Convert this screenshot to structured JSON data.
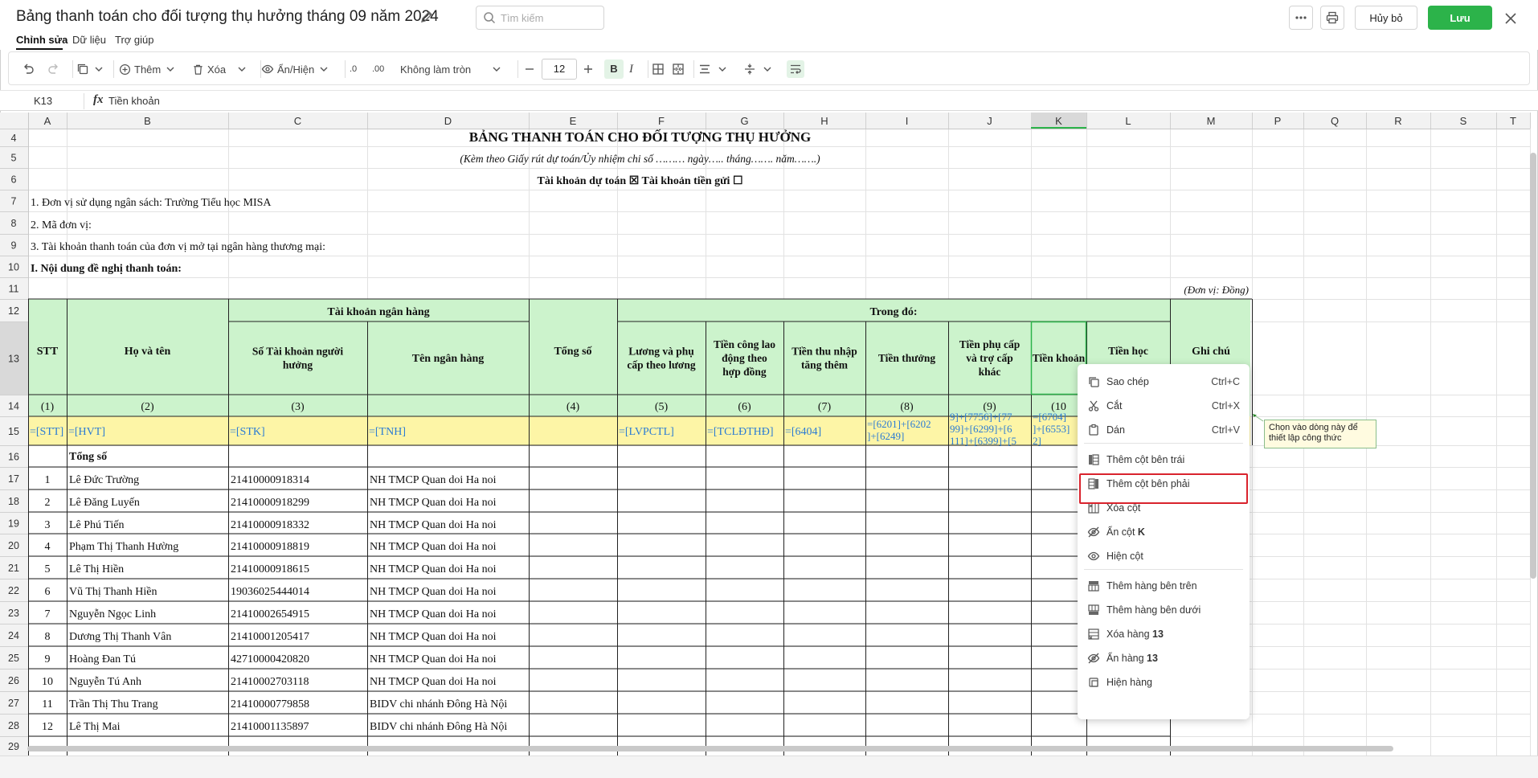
{
  "header": {
    "title": "Bảng thanh toán cho đối tượng thụ hưởng tháng 09 năm 2024",
    "search_placeholder": "Tìm kiếm",
    "tabs": [
      "Chỉnh sửa",
      "Dữ liệu",
      "Trợ giúp"
    ],
    "cancel_label": "Hủy bỏ",
    "save_label": "Lưu"
  },
  "toolbar": {
    "add_label": "Thêm",
    "delete_label": "Xóa",
    "show_hide_label": "Ẩn/Hiện",
    "decimal_down": ".0",
    "decimal_up": ".00",
    "rounding_value": "Không làm tròn",
    "font_size": "12",
    "bold_label": "B",
    "italic_label": "I"
  },
  "formula_bar": {
    "cell_ref": "K13",
    "fx": "fx",
    "value": "Tiền khoản"
  },
  "grid": {
    "columns": [
      "A",
      "B",
      "C",
      "D",
      "E",
      "F",
      "G",
      "H",
      "I",
      "J",
      "K",
      "L",
      "M",
      "P",
      "Q",
      "R",
      "S",
      "T"
    ],
    "selected_col": "K",
    "row_numbers": [
      "4",
      "5",
      "6",
      "7",
      "8",
      "9",
      "10",
      "11",
      "12",
      "13",
      "14",
      "15",
      "16",
      "17",
      "18",
      "19",
      "20",
      "21",
      "22",
      "23",
      "24",
      "25",
      "26",
      "27",
      "28",
      "29"
    ],
    "selected_row": "13",
    "title": "BẢNG THANH TOÁN CHO ĐỐI TƯỢNG THỤ HƯỞNG",
    "subtitle": "(Kèm theo Giấy rút dự toán/Ủy nhiệm chi số ……… ngày….. tháng……. năm…….)",
    "accounts": "Tài khoản dự toán ☒    Tài khoản tiền gửi ☐",
    "line7": "1. Đơn vị sử dụng ngân sách: Trường Tiểu học MISA",
    "line8": "2. Mã đơn vị:",
    "line9": "3. Tài khoản thanh toán của đơn vị mở tại ngân hàng thương mại:",
    "line10": "I. Nội dung đề nghị thanh toán:",
    "unit_note": "(Đơn vị: Đồng)",
    "hdr_stt": "STT",
    "hdr_name": "Họ và tên",
    "hdr_bank": "Tài khoản ngân hàng",
    "hdr_account": "Số Tài khoản người hưởng",
    "hdr_bankname": "Tên ngân hàng",
    "hdr_total": "Tổng số",
    "hdr_of_which": "Trong đó:",
    "hdr_note": "Ghi chú",
    "hdr_f": "Lương và phụ cấp theo lương",
    "hdr_g": "Tiền công lao động theo hợp đồng",
    "hdr_h": "Tiền thu nhập tăng thêm",
    "hdr_i": "Tiền thưởng",
    "hdr_j": "Tiền phụ cấp và trợ cấp khác",
    "hdr_k": "Tiền khoản",
    "hdr_l": "Tiền học",
    "row14": [
      "(1)",
      "(2)",
      "(3)",
      "",
      "(4)",
      "(5)",
      "(6)",
      "(7)",
      "(8)",
      "(9)",
      "(10"
    ],
    "row15": [
      "=[STT]",
      "=[HVT]",
      "=[STK]",
      "=[TNH]",
      "",
      "=[LVPCTL]",
      "=[TCLĐTHĐ]",
      "=[6404]"
    ],
    "row15_i": [
      "=[6201]+[6202",
      "]+[6249]"
    ],
    "row15_j": [
      "9]+[7756]+[77",
      "99]+[6299]+[6",
      "111]+[6399]+[5"
    ],
    "row15_k": [
      "=[6704]",
      "]+[6553]",
      "2]"
    ],
    "total_label": "Tổng số",
    "rows": [
      {
        "stt": "1",
        "name": "Lê Đức Trường",
        "account": "21410000918314",
        "bank": "NH TMCP Quan doi Ha noi"
      },
      {
        "stt": "2",
        "name": "Lê Đăng Luyến",
        "account": "21410000918299",
        "bank": "NH TMCP Quan doi Ha noi"
      },
      {
        "stt": "3",
        "name": "Lê Phú Tiến",
        "account": "21410000918332",
        "bank": "NH TMCP Quan doi Ha noi"
      },
      {
        "stt": "4",
        "name": "Phạm Thị Thanh  Hường",
        "account": "21410000918819",
        "bank": "NH TMCP Quan doi Ha noi"
      },
      {
        "stt": "5",
        "name": "Lê Thị Hiền",
        "account": "21410000918615",
        "bank": "NH TMCP Quan doi Ha noi"
      },
      {
        "stt": "6",
        "name": "Vũ Thị Thanh Hiền",
        "account": "19036025444014",
        "bank": "NH TMCP Quan doi Ha noi"
      },
      {
        "stt": "7",
        "name": "Nguyễn Ngọc Linh",
        "account": "21410002654915",
        "bank": "NH TMCP Quan doi Ha noi"
      },
      {
        "stt": "8",
        "name": "Dương Thị Thanh Vân",
        "account": "21410001205417",
        "bank": "NH TMCP Quan doi Ha noi"
      },
      {
        "stt": "9",
        "name": "Hoàng Đan Tú",
        "account": "42710000420820",
        "bank": "NH TMCP Quan doi Ha noi"
      },
      {
        "stt": "10",
        "name": "Nguyễn Tú Anh",
        "account": "21410002703118",
        "bank": "NH TMCP Quan doi Ha noi"
      },
      {
        "stt": "11",
        "name": "Trần Thị Thu Trang",
        "account": "21410000779858",
        "bank": "BIDV chi nhánh Đông Hà Nội"
      },
      {
        "stt": "12",
        "name": "Lê Thị Mai",
        "account": "21410001135897",
        "bank": "BIDV chi nhánh Đông Hà Nội"
      }
    ]
  },
  "context_menu": {
    "items": [
      {
        "label": "Sao chép",
        "shortcut": "Ctrl+C",
        "icon": "copy-icon"
      },
      {
        "label": "Cắt",
        "shortcut": "Ctrl+X",
        "icon": "cut-icon"
      },
      {
        "label": "Dán",
        "shortcut": "Ctrl+V",
        "icon": "paste-icon"
      },
      {
        "label": "Thêm cột bên trái",
        "shortcut": "",
        "icon": "insert-column-left-icon"
      },
      {
        "label": "Thêm cột bên phải",
        "shortcut": "",
        "icon": "insert-column-right-icon"
      },
      {
        "label": "Xóa cột",
        "shortcut": "",
        "icon": "delete-column-icon"
      },
      {
        "label": "Ẩn cột",
        "bold": "K",
        "shortcut": "",
        "icon": "hide-icon"
      },
      {
        "label": "Hiện cột",
        "shortcut": "",
        "icon": "show-icon"
      },
      {
        "label": "Thêm hàng bên trên",
        "shortcut": "",
        "icon": "insert-row-above-icon"
      },
      {
        "label": "Thêm hàng bên dưới",
        "shortcut": "",
        "icon": "insert-row-below-icon"
      },
      {
        "label": "Xóa hàng",
        "bold": "13",
        "shortcut": "",
        "icon": "delete-row-icon"
      },
      {
        "label": "Ẩn hàng",
        "bold": "13",
        "shortcut": "",
        "icon": "hide-icon"
      },
      {
        "label": "Hiện hàng",
        "shortcut": "",
        "icon": "unhide-row-icon"
      }
    ]
  },
  "tooltip": {
    "text": "Chọn vào dòng này để thiết lập công thức"
  },
  "colors": {
    "save_green": "#2cb34a",
    "header_fill": "#ccf3cc",
    "formula_row_fill": "#fdf5a6",
    "link_blue": "#2a7bd4",
    "highlight_red": "#d9232d"
  }
}
